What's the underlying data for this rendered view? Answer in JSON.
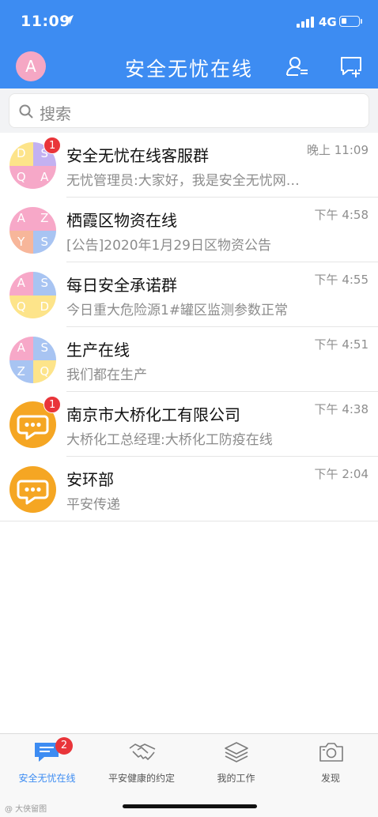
{
  "status_bar": {
    "time": "11:09",
    "network": "4G"
  },
  "header": {
    "avatar_letter": "A",
    "title": "安全无忧在线"
  },
  "search": {
    "placeholder": "搜索"
  },
  "chats": [
    {
      "name": "安全无忧在线客服群",
      "preview": "无忧管理员:大家好，我是安全无忧网…",
      "time": "晚上 11:09",
      "unread": "1",
      "avatar": {
        "type": "grid",
        "letters": [
          "D",
          "S",
          "Q",
          "A"
        ],
        "colors": [
          "#fde48a",
          "#c3b1f1",
          "#f6a8c8",
          "#f6a8c8"
        ]
      }
    },
    {
      "name": "栖霞区物资在线",
      "preview": "[公告]2020年1月29日区物资公告",
      "time": "下午 4:58",
      "unread": "",
      "avatar": {
        "type": "grid",
        "letters": [
          "A",
          "Z",
          "Y",
          "S"
        ],
        "colors": [
          "#f7a8c8",
          "#f7a8c8",
          "#f7b69a",
          "#a8c4f2"
        ]
      }
    },
    {
      "name": "每日安全承诺群",
      "preview": "今日重大危险源1#罐区监测参数正常",
      "time": "下午 4:55",
      "unread": "",
      "avatar": {
        "type": "grid",
        "letters": [
          "A",
          "S",
          "Q",
          "D"
        ],
        "colors": [
          "#f7a8c8",
          "#a8c4f2",
          "#fde48a",
          "#fde48a"
        ]
      }
    },
    {
      "name": "生产在线",
      "preview": "我们都在生产",
      "time": "下午 4:51",
      "unread": "",
      "avatar": {
        "type": "grid",
        "letters": [
          "A",
          "S",
          "Z",
          "Q"
        ],
        "colors": [
          "#f7a8c8",
          "#a8c4f2",
          "#a8c4f2",
          "#fde48a"
        ]
      }
    },
    {
      "name": "南京市大桥化工有限公司",
      "preview": "大桥化工总经理:大桥化工防疫在线",
      "time": "下午 4:38",
      "unread": "1",
      "avatar": {
        "type": "bubble",
        "color": "#f5a623"
      }
    },
    {
      "name": "安环部",
      "preview": "平安传递",
      "time": "下午 2:04",
      "unread": "",
      "avatar": {
        "type": "bubble",
        "color": "#f5a623"
      }
    }
  ],
  "tabs": [
    {
      "label": "安全无忧在线",
      "icon": "chat-bubble-icon",
      "badge": "2",
      "active": true
    },
    {
      "label": "平安健康的约定",
      "icon": "handshake-icon",
      "badge": "",
      "active": false
    },
    {
      "label": "我的工作",
      "icon": "layers-icon",
      "badge": "",
      "active": false
    },
    {
      "label": "发现",
      "icon": "camera-icon",
      "badge": "",
      "active": false
    }
  ],
  "watermark": "@ 大侠留图",
  "colors": {
    "primary": "#3d8cf2",
    "badge": "#e9353a",
    "bubble_avatar": "#f5a623"
  }
}
